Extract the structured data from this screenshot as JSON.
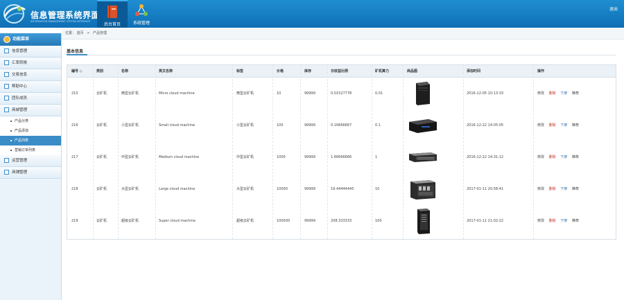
{
  "header": {
    "title": "信息管理系统界面",
    "subtitle": "INFORMATION MANAGEMENT SYSTEM INTERFACE",
    "right_link": "退出",
    "nav": [
      {
        "label": "后台首页",
        "icon": "book-icon",
        "active": true
      },
      {
        "label": "系统管理",
        "icon": "network-icon",
        "active": false
      }
    ]
  },
  "sidebar": {
    "title": "功能菜单",
    "items_before": [
      "信息管理",
      "汇率转换",
      "交易信息",
      "帮助中心",
      "团队成员"
    ],
    "group": "商城管理",
    "sub_items": [
      {
        "label": "产品分类",
        "active": false
      },
      {
        "label": "产品添加",
        "active": false
      },
      {
        "label": "产品列表",
        "active": true
      },
      {
        "label": "营销订单列表",
        "active": false
      }
    ],
    "items_after": [
      "运营管理",
      "商铺管理"
    ]
  },
  "breadcrumb": {
    "prefix": "位置：",
    "home": "首页",
    "sep": ">",
    "current": "产品管理"
  },
  "section": {
    "title": "基本信息"
  },
  "table": {
    "columns": [
      "编号",
      "类别",
      "名称",
      "英文名称",
      "标签",
      "价格",
      "库存",
      "日收益比例",
      "矿机算力",
      "商品图",
      "添加时间",
      "操作"
    ],
    "sort_marker": "◇",
    "rows": [
      {
        "id": "210",
        "cat": "云矿机",
        "name": "微型云矿机",
        "en": "Micro cloud machine",
        "tag": "微型云矿机",
        "price": "10",
        "stock": "99999",
        "ratio": "0.01527778",
        "power": "0.01",
        "img": "tower-small",
        "time": "2016-12-05 10:13:33"
      },
      {
        "id": "216",
        "cat": "云矿机",
        "name": "小型云矿机",
        "en": "Small cloud machine",
        "tag": "小型云矿机",
        "price": "100",
        "stock": "99999",
        "ratio": "0.16666667",
        "power": "0.1",
        "img": "flat-box",
        "time": "2016-12-22 14:05:05"
      },
      {
        "id": "217",
        "cat": "云矿机",
        "name": "中型云矿机",
        "en": "Medium cloud machine",
        "tag": "中型云矿机",
        "price": "1000",
        "stock": "99999",
        "ratio": "1.66666666",
        "power": "1",
        "img": "rack-1u",
        "time": "2016-12-22 14:31:12"
      },
      {
        "id": "218",
        "cat": "云矿机",
        "name": "大型云矿机",
        "en": "Large cloud machine",
        "tag": "大型云矿机",
        "price": "10000",
        "stock": "99999",
        "ratio": "19.44444445",
        "power": "10",
        "img": "rack-4u",
        "time": "2017-01-11 20:58:41"
      },
      {
        "id": "219",
        "cat": "云矿机",
        "name": "超级云矿机",
        "en": "Super cloud machine",
        "tag": "超级云矿机",
        "price": "100000",
        "stock": "99999",
        "ratio": "208.333333",
        "power": "100",
        "img": "tower-large",
        "time": "2017-01-11 21:02:22"
      }
    ],
    "actions": [
      "修改",
      "删除",
      "下架",
      "推荐"
    ]
  }
}
